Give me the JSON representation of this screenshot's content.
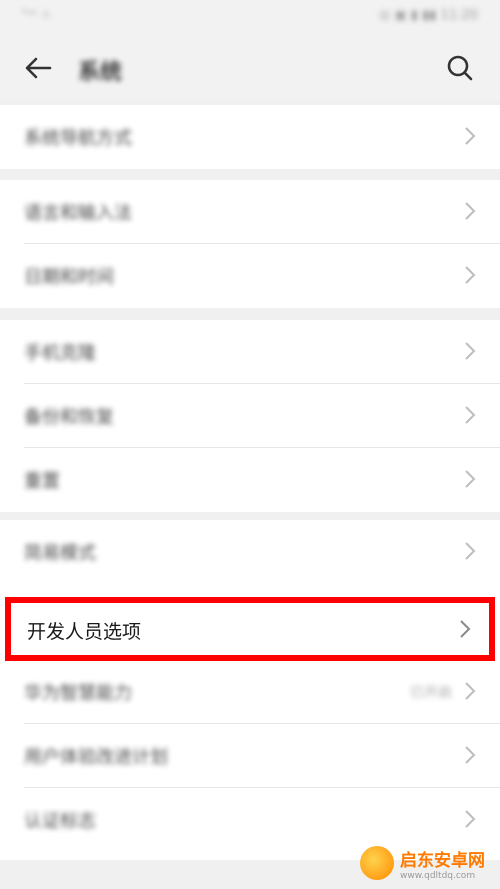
{
  "status": {
    "left": "ᵀᵃˡ ⌾",
    "right": "◎ ▣ ▮ ▮▮ 11:20"
  },
  "header": {
    "title": "系统"
  },
  "groups": [
    {
      "items": [
        {
          "label": "系统导航方式"
        }
      ]
    },
    {
      "items": [
        {
          "label": "语言和输入法"
        },
        {
          "label": "日期和时间"
        }
      ]
    },
    {
      "items": [
        {
          "label": "手机克隆"
        },
        {
          "label": "备份和恢复"
        },
        {
          "label": "重置"
        }
      ]
    },
    {
      "items": [
        {
          "label": "简易模式"
        }
      ]
    }
  ],
  "highlighted": {
    "label": "开发人员选项"
  },
  "after": [
    {
      "label": "华为智慧能力",
      "value": "已开启"
    },
    {
      "label": "用户体验改进计划"
    },
    {
      "label": "认证标志"
    }
  ],
  "watermark": {
    "line1": "启东安卓网",
    "line2": "www.qdltdq.com"
  },
  "colors": {
    "highlight": "#ff0000",
    "background": "#f0f0f0",
    "card": "#ffffff"
  }
}
